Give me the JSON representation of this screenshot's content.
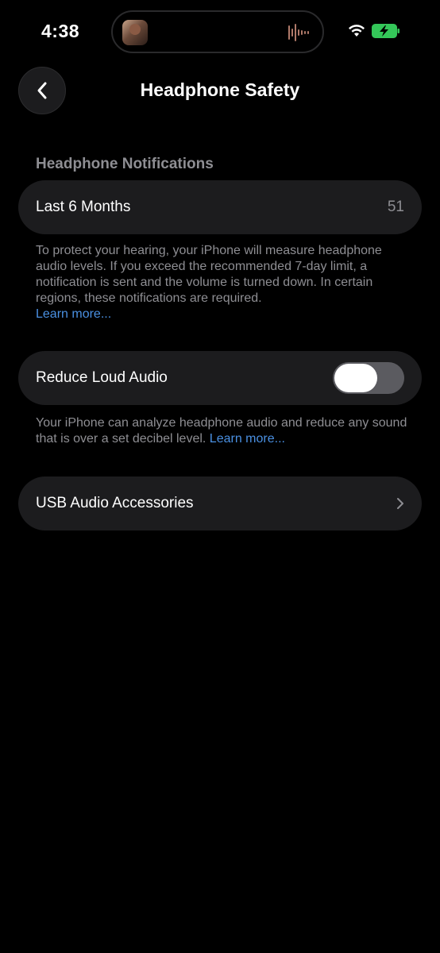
{
  "status_bar": {
    "time": "4:38"
  },
  "nav": {
    "title": "Headphone Safety"
  },
  "notifications_section": {
    "header": "Headphone Notifications",
    "row_label": "Last 6 Months",
    "row_value": "51",
    "footer_text": "To protect your hearing, your iPhone will measure headphone audio levels. If you exceed the recommended 7-day limit, a notification is sent and the volume is turned down. In certain regions, these notifications are required.",
    "footer_link": "Learn more..."
  },
  "reduce_loud_audio": {
    "label": "Reduce Loud Audio",
    "enabled": false,
    "footer_text": "Your iPhone can analyze headphone audio and reduce any sound that is over a set decibel level.",
    "footer_link": "Learn more..."
  },
  "usb_accessories": {
    "label": "USB Audio Accessories"
  },
  "colors": {
    "background": "#000000",
    "cell": "#1c1c1e",
    "secondary_text": "#8e8e93",
    "link": "#4a90e2",
    "battery_charging": "#34c759"
  }
}
